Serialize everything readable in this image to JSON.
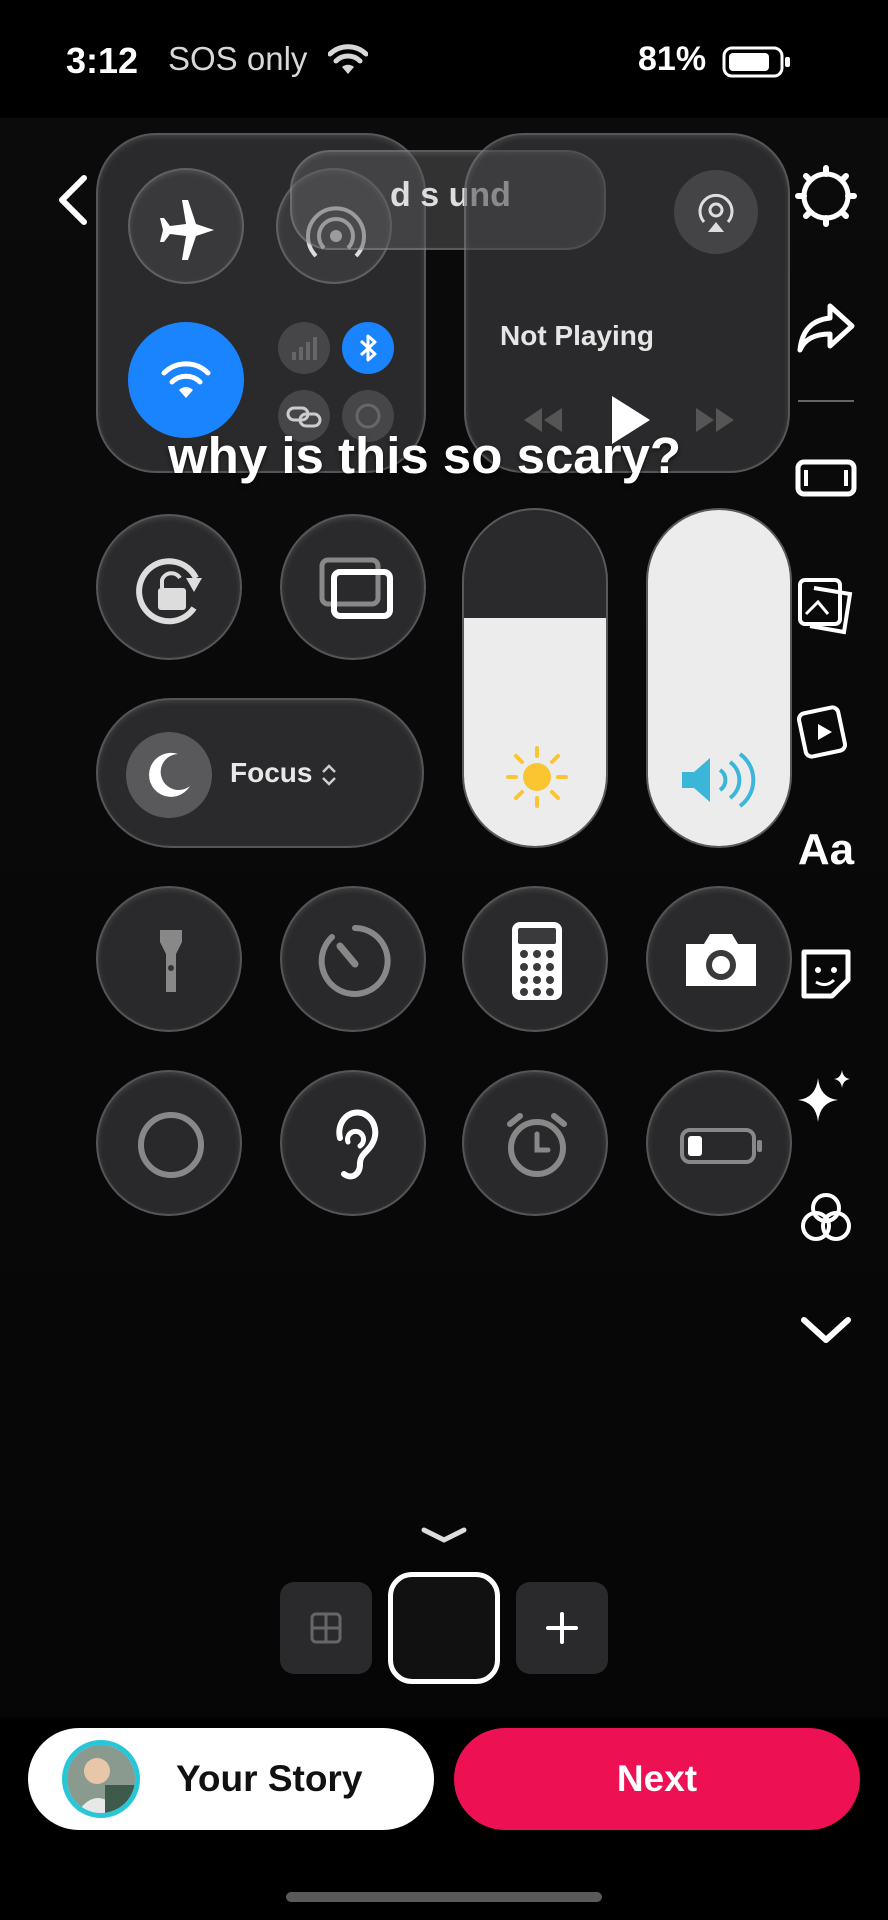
{
  "status_bar": {
    "time": "3:12",
    "carrier": "SOS only",
    "battery_percent": "81%",
    "battery_level": 0.81
  },
  "control_center": {
    "overlay_text": "d s und",
    "media": {
      "status": "Not Playing"
    },
    "focus": {
      "label": "Focus"
    },
    "brightness_level": 0.68,
    "volume_level": 1.0,
    "wifi_active_color": "#1a84ff"
  },
  "caption": "why is this so scary?",
  "side_toolbar": {
    "items": [
      "gear-icon",
      "share-arrow-icon",
      "aspect-ratio-icon",
      "photo-stack-icon",
      "video-icon",
      "Aa",
      "sticker-icon",
      "sparkle-icon",
      "circles-icon",
      "chevron-down-icon"
    ]
  },
  "bottom": {
    "your_story_label": "Your Story",
    "next_label": "Next",
    "next_color": "#ed1153"
  }
}
